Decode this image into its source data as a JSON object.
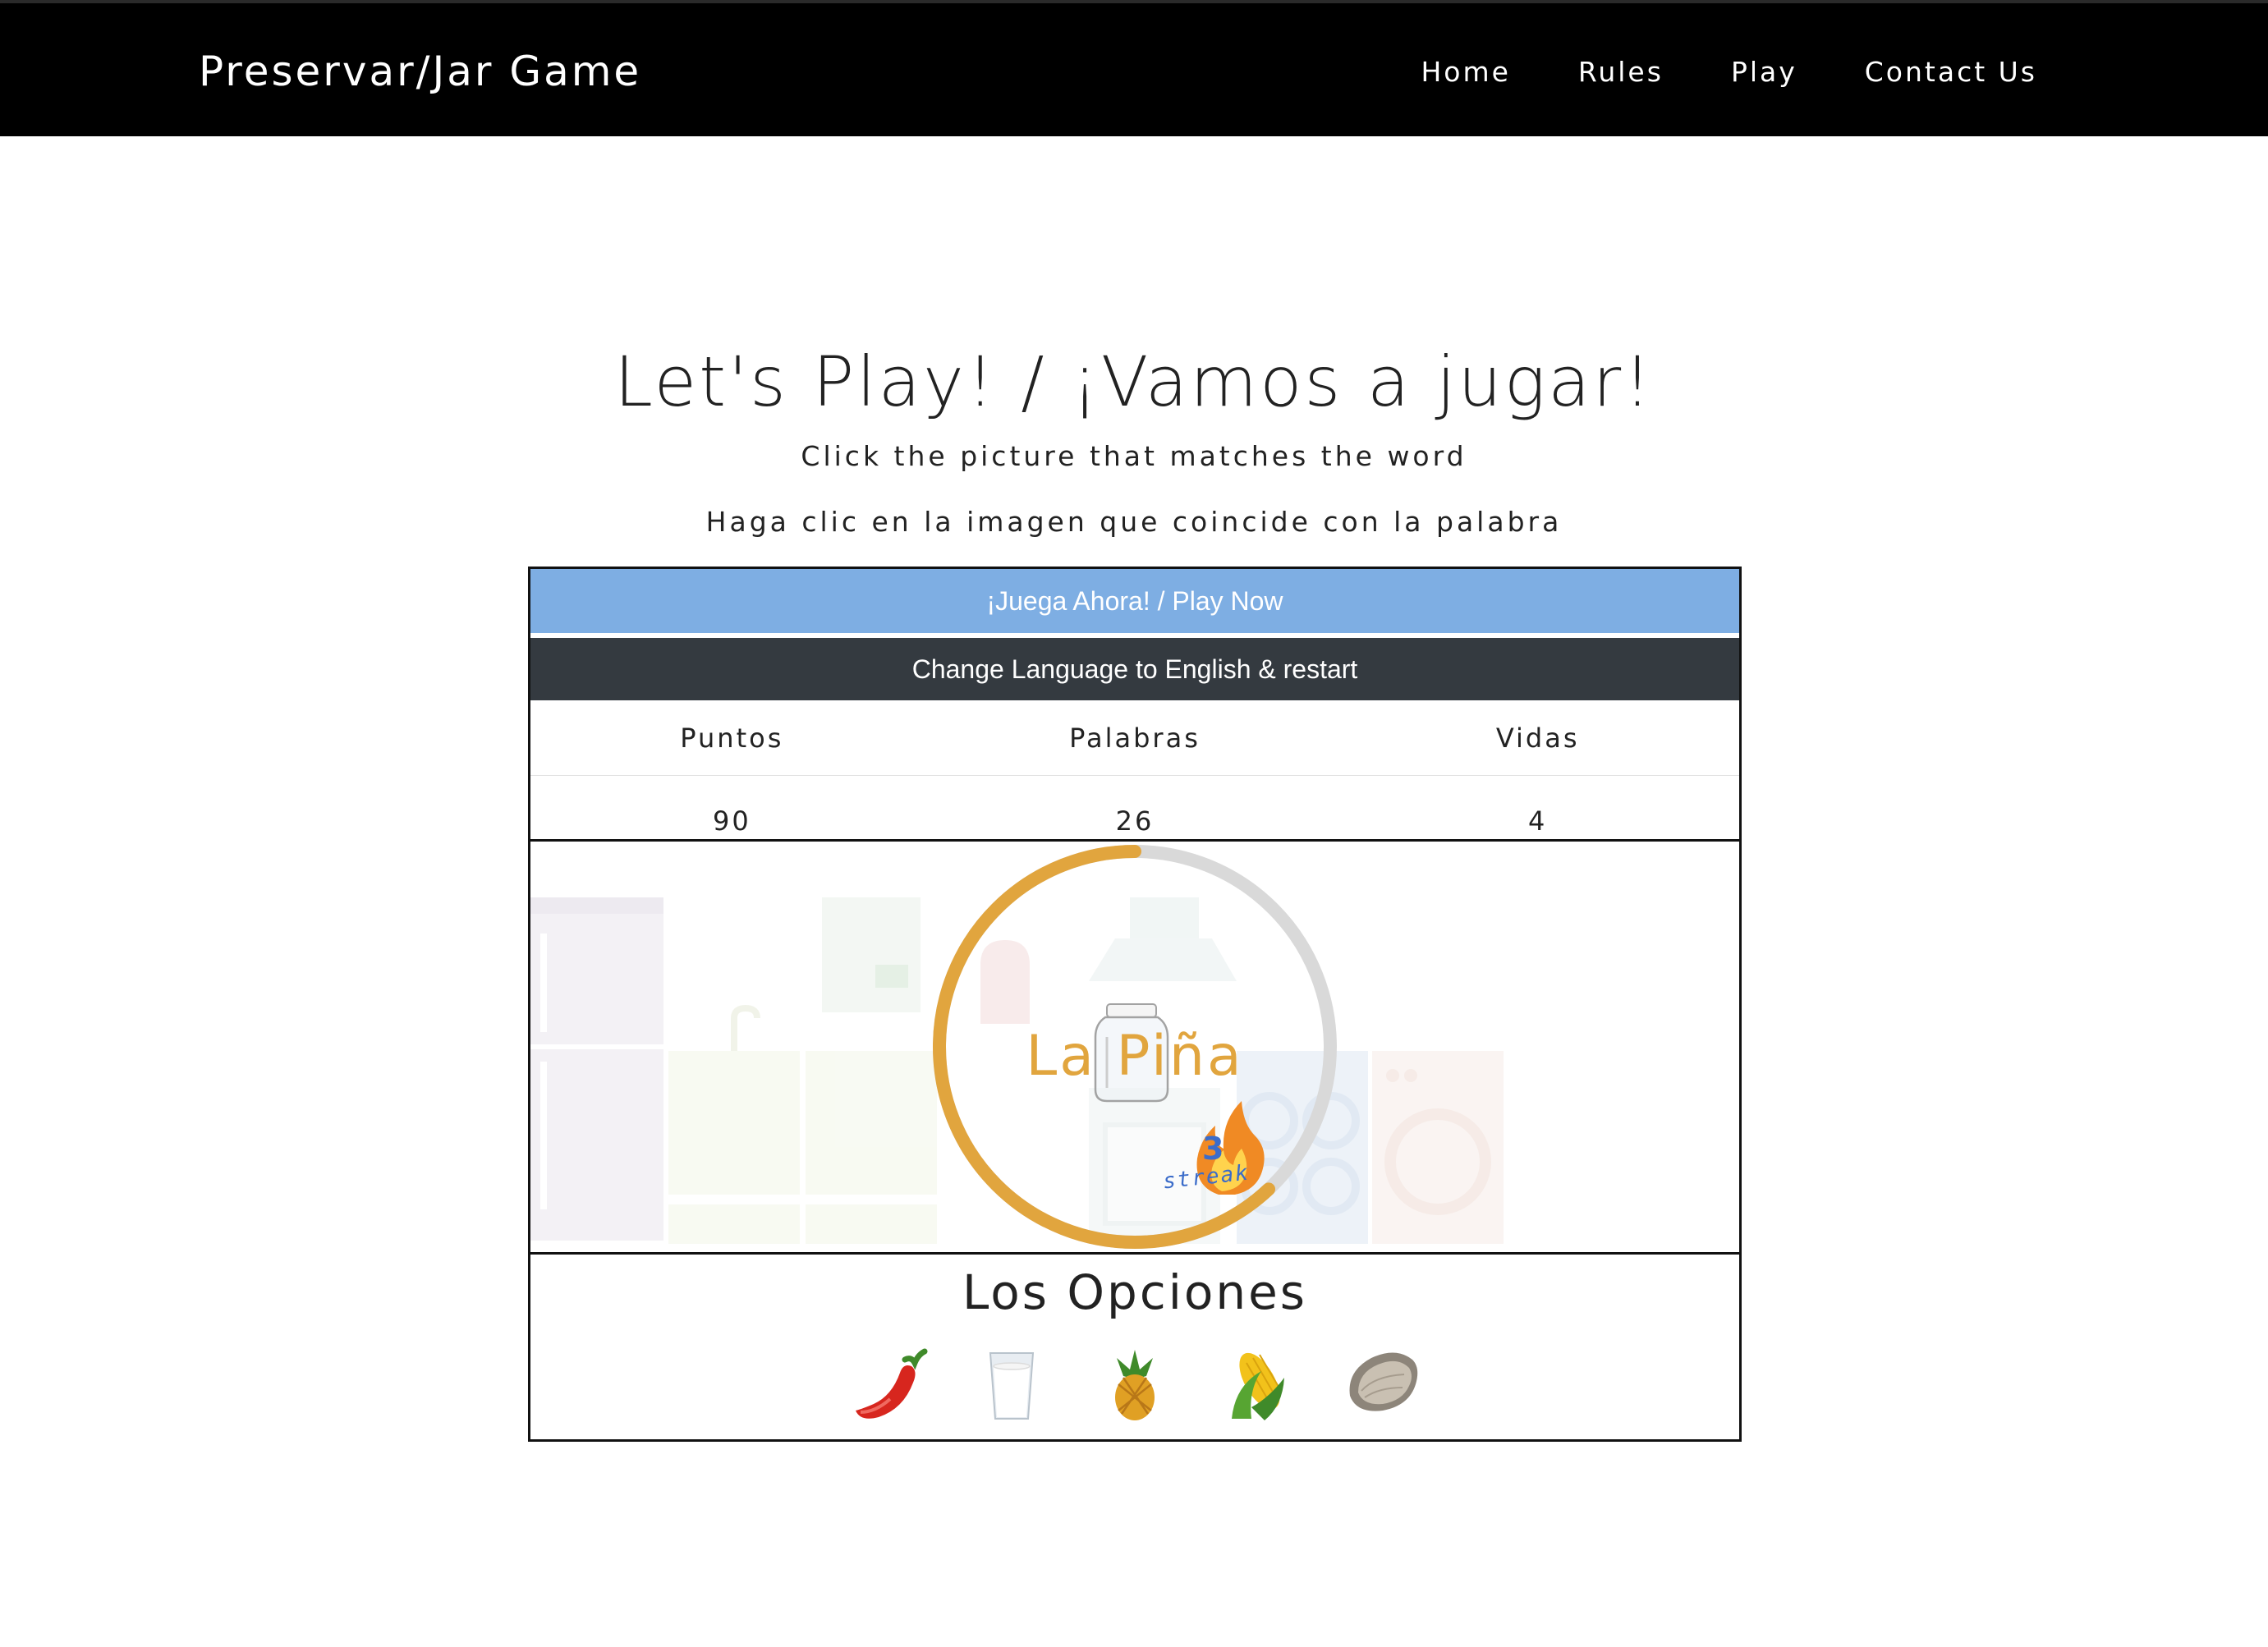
{
  "nav": {
    "brand": "Preservar/Jar Game",
    "links": [
      "Home",
      "Rules",
      "Play",
      "Contact Us"
    ]
  },
  "heading": {
    "title": "Let's Play! / ¡Vamos a jugar!",
    "subtitle_en": "Click the picture that matches the word",
    "subtitle_es": "Haga clic en la imagen que coincide con la palabra"
  },
  "game": {
    "play_button": "¡Juega Ahora! / Play Now",
    "language_button": "Change Language to English & restart",
    "stats": {
      "headers": [
        "Puntos",
        "Palabras",
        "Vidas"
      ],
      "values": [
        "90",
        "26",
        "4"
      ]
    },
    "timer": {
      "remaining_fraction": 0.62,
      "color": "#e1a53e",
      "track_color": "#d9d9d9"
    },
    "word": "La Piña",
    "streak": {
      "count": "3",
      "label": "streak",
      "icon": "fire-icon"
    },
    "options_title": "Los Opciones",
    "options": [
      {
        "icon": "chili-pepper-icon"
      },
      {
        "icon": "milk-glass-icon"
      },
      {
        "icon": "pineapple-icon"
      },
      {
        "icon": "corn-icon"
      },
      {
        "icon": "oyster-icon"
      }
    ]
  },
  "colors": {
    "nav_bg": "#000000",
    "play_button_bg": "#7eaee3",
    "language_button_bg": "#343a40",
    "accent": "#e1a53e"
  }
}
